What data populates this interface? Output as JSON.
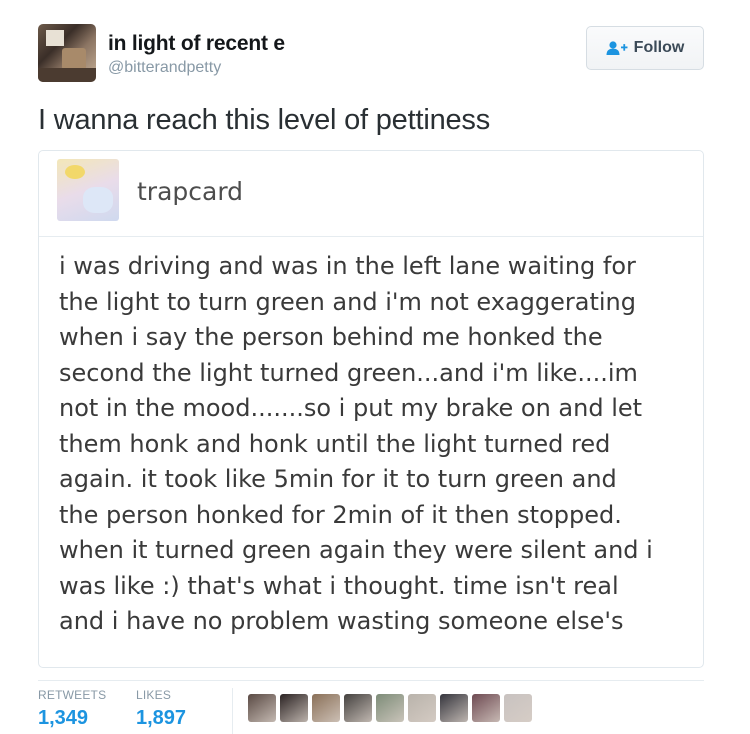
{
  "author": {
    "display_name": "in light of recent e",
    "handle": "@bitterandpetty",
    "avatar_icon": "user-avatar"
  },
  "follow_button": {
    "label": "Follow",
    "icon": "follow-user-plus-icon"
  },
  "tweet": {
    "text": "I wanna reach this level of pettiness"
  },
  "quoted": {
    "name": "trapcard",
    "lines": [
      "i was driving and was in the left lane waiting for",
      "the light to turn green and i'm not exaggerating",
      "when i say the person behind me honked the",
      "second the light turned green...and i'm like....im",
      "not in the mood.......so i put my brake on and let",
      "them honk and honk until the light turned red",
      "again. it took like 5min for it to turn green and",
      "the person honked for 2min of it then stopped.",
      "when it turned green again they were silent and i",
      "was like :) that's what i thought. time isn't real",
      "and i have no problem wasting someone else's"
    ]
  },
  "stats": {
    "retweets_label": "RETWEETS",
    "retweets_value": "1,349",
    "likes_label": "LIKES",
    "likes_value": "1,897"
  },
  "likers": {
    "colors": [
      "#5a4a44",
      "#2b2323",
      "#8a7058",
      "#44413f",
      "#7d8c78",
      "#b9b3ab",
      "#35353d",
      "#6e4a52",
      "#c8c2c0"
    ]
  },
  "colors": {
    "accent": "#1c94e0",
    "muted": "#8899a6"
  }
}
